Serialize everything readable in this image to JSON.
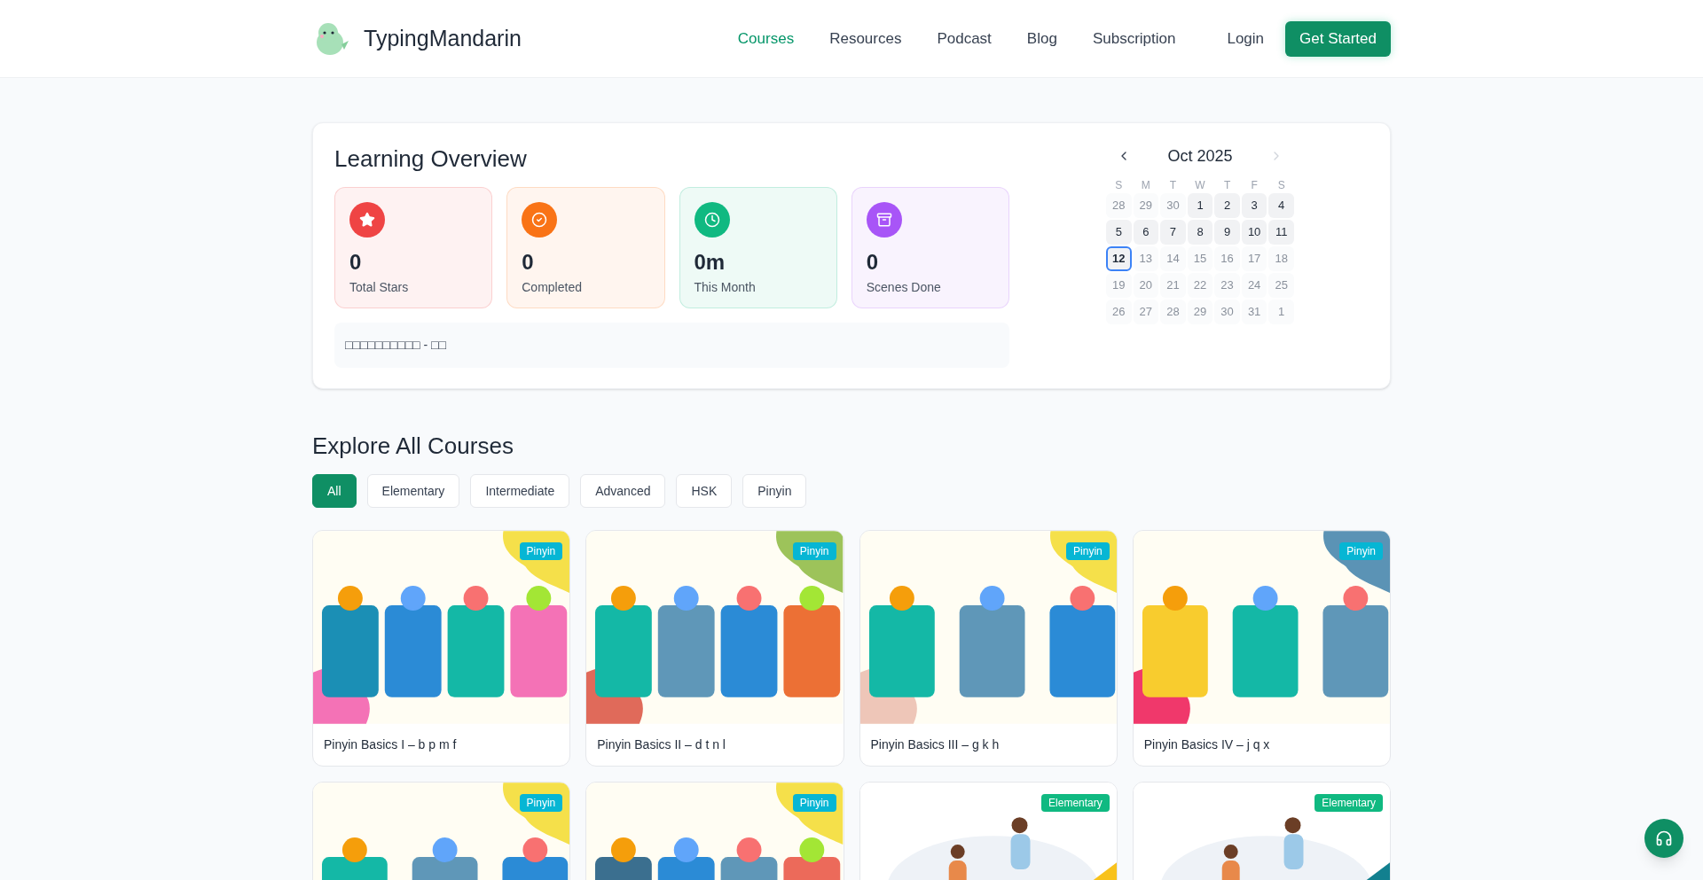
{
  "header": {
    "brand": "TypingMandarin",
    "nav": [
      {
        "label": "Courses",
        "selected": true
      },
      {
        "label": "Resources",
        "selected": false
      },
      {
        "label": "Podcast",
        "selected": false
      },
      {
        "label": "Blog",
        "selected": false
      },
      {
        "label": "Subscription",
        "selected": false
      }
    ],
    "login": "Login",
    "cta": "Get Started"
  },
  "overview": {
    "title": "Learning Overview",
    "stats": [
      {
        "value": "0",
        "label": "Total Stars",
        "color": "#ef4444"
      },
      {
        "value": "0",
        "label": "Completed",
        "color": "#f97316"
      },
      {
        "value": "0m",
        "label": "This Month",
        "color": "#10b981"
      },
      {
        "value": "0",
        "label": "Scenes Done",
        "color": "#a855f7"
      }
    ],
    "banner": "□□□□□□□□□□ - □□",
    "calendar": {
      "month": "Oct 2025",
      "next_disabled": true,
      "weekdays": [
        "S",
        "M",
        "T",
        "W",
        "T",
        "F",
        "S"
      ],
      "weeks": [
        [
          {
            "day": "28",
            "muted": true,
            "selected": false
          },
          {
            "day": "29",
            "muted": true,
            "selected": false
          },
          {
            "day": "30",
            "muted": true,
            "selected": false
          },
          {
            "day": "1",
            "muted": false,
            "selected": false
          },
          {
            "day": "2",
            "muted": false,
            "selected": false
          },
          {
            "day": "3",
            "muted": false,
            "selected": false
          },
          {
            "day": "4",
            "muted": false,
            "selected": false
          }
        ],
        [
          {
            "day": "5",
            "muted": false,
            "selected": false
          },
          {
            "day": "6",
            "muted": false,
            "selected": false
          },
          {
            "day": "7",
            "muted": false,
            "selected": false
          },
          {
            "day": "8",
            "muted": false,
            "selected": false
          },
          {
            "day": "9",
            "muted": false,
            "selected": false
          },
          {
            "day": "10",
            "muted": false,
            "selected": false
          },
          {
            "day": "11",
            "muted": false,
            "selected": false
          }
        ],
        [
          {
            "day": "12",
            "muted": false,
            "selected": true
          },
          {
            "day": "13",
            "muted": true,
            "selected": false
          },
          {
            "day": "14",
            "muted": true,
            "selected": false
          },
          {
            "day": "15",
            "muted": true,
            "selected": false
          },
          {
            "day": "16",
            "muted": true,
            "selected": false
          },
          {
            "day": "17",
            "muted": true,
            "selected": false
          },
          {
            "day": "18",
            "muted": true,
            "selected": false
          }
        ],
        [
          {
            "day": "19",
            "muted": true,
            "selected": false
          },
          {
            "day": "20",
            "muted": true,
            "selected": false
          },
          {
            "day": "21",
            "muted": true,
            "selected": false
          },
          {
            "day": "22",
            "muted": true,
            "selected": false
          },
          {
            "day": "23",
            "muted": true,
            "selected": false
          },
          {
            "day": "24",
            "muted": true,
            "selected": false
          },
          {
            "day": "25",
            "muted": true,
            "selected": false
          }
        ],
        [
          {
            "day": "26",
            "muted": true,
            "selected": false
          },
          {
            "day": "27",
            "muted": true,
            "selected": false
          },
          {
            "day": "28",
            "muted": true,
            "selected": false
          },
          {
            "day": "29",
            "muted": true,
            "selected": false
          },
          {
            "day": "30",
            "muted": true,
            "selected": false
          },
          {
            "day": "31",
            "muted": true,
            "selected": false
          },
          {
            "day": "1",
            "muted": true,
            "selected": false
          }
        ]
      ]
    }
  },
  "courses": {
    "title": "Explore All Courses",
    "filters": [
      {
        "label": "All",
        "selected": true
      },
      {
        "label": "Elementary",
        "selected": false
      },
      {
        "label": "Intermediate",
        "selected": false
      },
      {
        "label": "Advanced",
        "selected": false
      },
      {
        "label": "HSK",
        "selected": false
      },
      {
        "label": "Pinyin",
        "selected": false
      }
    ],
    "items": [
      {
        "title": "Pinyin Basics I – b p m f",
        "badge": "Pinyin",
        "color": "#06b6d4",
        "kind": "pinyin"
      },
      {
        "title": "Pinyin Basics II – d t n l",
        "badge": "Pinyin",
        "color": "#06b6d4",
        "kind": "pinyin"
      },
      {
        "title": "Pinyin Basics III – g k h",
        "badge": "Pinyin",
        "color": "#06b6d4",
        "kind": "pinyin"
      },
      {
        "title": "Pinyin Basics IV – j q x",
        "badge": "Pinyin",
        "color": "#06b6d4",
        "kind": "pinyin"
      },
      {
        "badge": "Pinyin",
        "color": "#06b6d4",
        "kind": "pinyin"
      },
      {
        "badge": "Pinyin",
        "color": "#06b6d4",
        "kind": "pinyin"
      },
      {
        "badge": "Elementary",
        "color": "#10b981",
        "kind": "hsk"
      },
      {
        "badge": "Elementary",
        "color": "#10b981",
        "kind": "hsk"
      }
    ]
  }
}
